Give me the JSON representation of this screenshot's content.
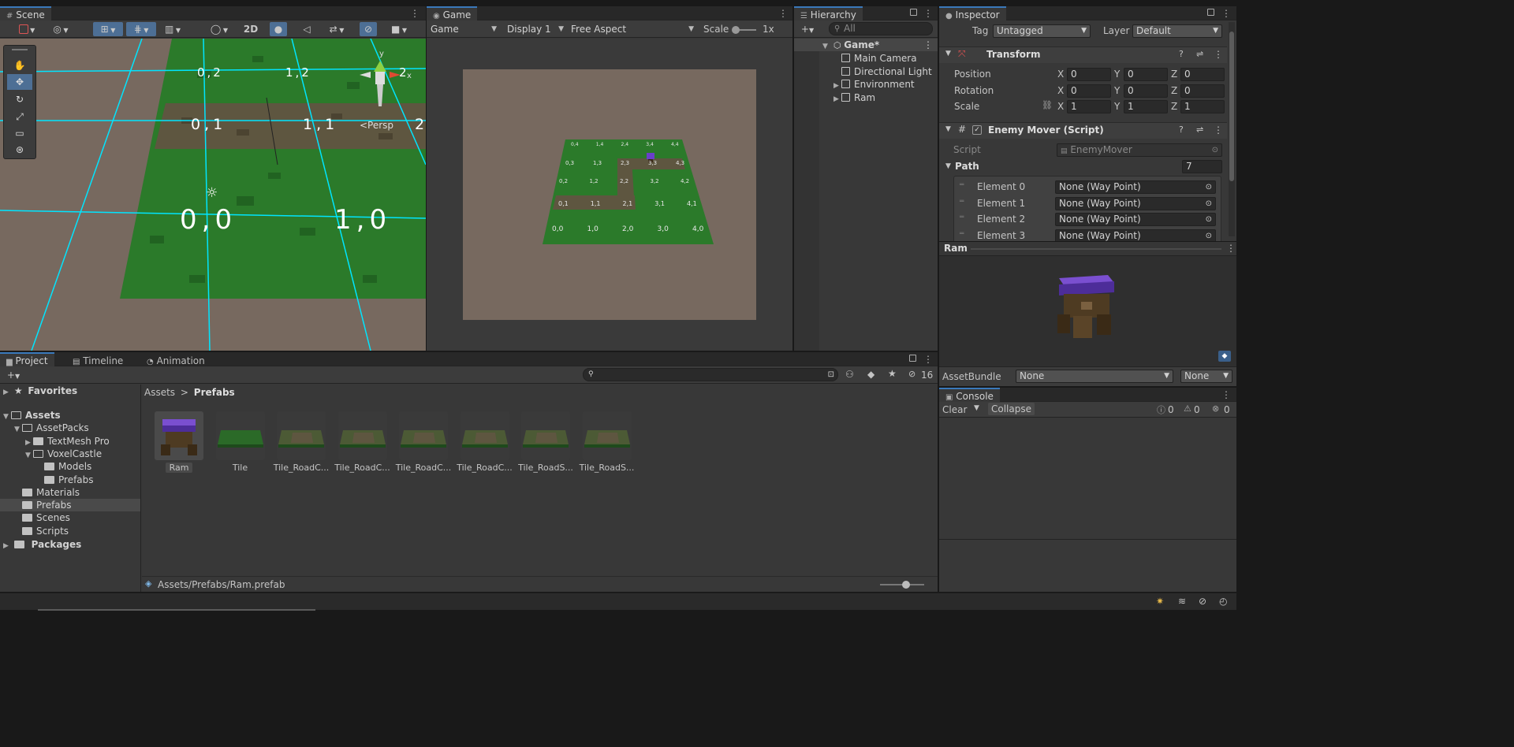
{
  "scene": {
    "tab": "Scene",
    "toggle_2d": "2D",
    "persp_label": "<Persp",
    "grid_labels": [
      "0,2",
      "1,2",
      "2",
      "0,1",
      "1,1",
      "2",
      "0,0",
      "1,0"
    ],
    "gizmo_axes": [
      "y",
      "x"
    ]
  },
  "game": {
    "tab": "Game",
    "mode": "Game",
    "display": "Display 1",
    "aspect": "Free Aspect",
    "scale_label": "Scale",
    "scale_value": "1x",
    "tile_labels": [
      "0,4",
      "1,4",
      "2,4",
      "3,4",
      "4,4",
      "0,3",
      "1,3",
      "2,3",
      "3,3",
      "4,3",
      "0,2",
      "1,2",
      "2,2",
      "3,2",
      "4,2",
      "0,1",
      "1,1",
      "2,1",
      "3,1",
      "4,1",
      "0,0",
      "1,0",
      "2,0",
      "3,0",
      "4,0"
    ]
  },
  "hierarchy": {
    "tab": "Hierarchy",
    "search_placeholder": "All",
    "scene_name": "Game*",
    "items": [
      {
        "name": "Main Camera",
        "expandable": false
      },
      {
        "name": "Directional Light",
        "expandable": false
      },
      {
        "name": "Environment",
        "expandable": true
      },
      {
        "name": "Ram",
        "expandable": true
      }
    ]
  },
  "inspector": {
    "tab": "Inspector",
    "tag_label": "Tag",
    "tag_value": "Untagged",
    "layer_label": "Layer",
    "layer_value": "Default",
    "transform": {
      "title": "Transform",
      "position": {
        "label": "Position",
        "x": "0",
        "y": "0",
        "z": "0"
      },
      "rotation": {
        "label": "Rotation",
        "x": "0",
        "y": "0",
        "z": "0"
      },
      "scale": {
        "label": "Scale",
        "x": "1",
        "y": "1",
        "z": "1"
      },
      "axis_x": "X",
      "axis_y": "Y",
      "axis_z": "Z"
    },
    "enemy_mover": {
      "title": "Enemy Mover (Script)",
      "script_label": "Script",
      "script_value": "EnemyMover",
      "path_label": "Path",
      "path_count": "7",
      "elements": [
        {
          "label": "Element 0",
          "value": "None (Way Point)"
        },
        {
          "label": "Element 1",
          "value": "None (Way Point)"
        },
        {
          "label": "Element 2",
          "value": "None (Way Point)"
        },
        {
          "label": "Element 3",
          "value": "None (Way Point)"
        }
      ]
    },
    "preview_title": "Ram",
    "assetbundle_label": "AssetBundle",
    "assetbundle_value": "None",
    "assetbundle_variant": "None"
  },
  "console": {
    "tab": "Console",
    "clear": "Clear",
    "collapse": "Collapse",
    "log_count": "0",
    "warn_count": "0",
    "error_count": "0"
  },
  "project": {
    "tabs": [
      "Project",
      "Timeline",
      "Animation"
    ],
    "hidden_count": "16",
    "favorites": "Favorites",
    "tree": [
      {
        "name": "Assets",
        "level": 0,
        "open": true
      },
      {
        "name": "AssetPacks",
        "level": 1,
        "open": true
      },
      {
        "name": "TextMesh Pro",
        "level": 2,
        "open": false
      },
      {
        "name": "VoxelCastle",
        "level": 2,
        "open": true
      },
      {
        "name": "Models",
        "level": 3,
        "open": false
      },
      {
        "name": "Prefabs",
        "level": 3,
        "open": false
      },
      {
        "name": "Materials",
        "level": 1,
        "open": false
      },
      {
        "name": "Prefabs",
        "level": 1,
        "open": false,
        "selected": true
      },
      {
        "name": "Scenes",
        "level": 1,
        "open": false
      },
      {
        "name": "Scripts",
        "level": 1,
        "open": false
      }
    ],
    "packages": "Packages",
    "breadcrumb": [
      "Assets",
      "Prefabs"
    ],
    "assets": [
      "Ram",
      "Tile",
      "Tile_RoadC...",
      "Tile_RoadC...",
      "Tile_RoadC...",
      "Tile_RoadC...",
      "Tile_RoadS...",
      "Tile_RoadS..."
    ],
    "status_path": "Assets/Prefabs/Ram.prefab"
  },
  "colors": {
    "accent": "#3a79bb",
    "selection": "#2c5d87",
    "grass": "#2f7d2b",
    "dirt": "#6a5a44",
    "grid": "#00e5ff"
  }
}
